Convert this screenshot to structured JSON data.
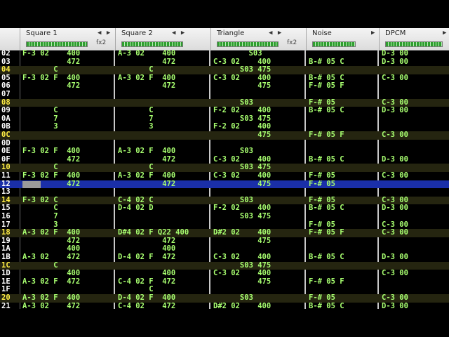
{
  "channels": [
    {
      "name": "Square 1",
      "fx": "fx2",
      "arrows": "◀ ▶"
    },
    {
      "name": "Square 2",
      "fx": "",
      "arrows": "◀ ▶"
    },
    {
      "name": "Triangle",
      "fx": "fx2",
      "arrows": "◀ ▶"
    },
    {
      "name": "Noise",
      "fx": "",
      "arrows": "▶"
    },
    {
      "name": "DPCM",
      "fx": "",
      "arrows": "▶"
    }
  ],
  "rows": [
    {
      "n": "02",
      "c": [
        "F-3 02    400",
        "A-3 02    400",
        "        S03  ",
        "",
        "D-3 00"
      ]
    },
    {
      "n": "03",
      "c": [
        "          472",
        "          472",
        "C-3 02    400",
        "B-# 05 C",
        "D-3 00"
      ]
    },
    {
      "n": "04",
      "c": [
        "       C     ",
        "       C     ",
        "      S03 475",
        "",
        ""
      ]
    },
    {
      "n": "05",
      "c": [
        "F-3 02 F  400",
        "A-3 02 F  400",
        "C-3 02    400",
        "B-# 05 C",
        "C-3 00"
      ]
    },
    {
      "n": "06",
      "c": [
        "          472",
        "          472",
        "          475",
        "F-# 05 F",
        ""
      ]
    },
    {
      "n": "07",
      "c": [
        "",
        "",
        "",
        "",
        ""
      ]
    },
    {
      "n": "08",
      "c": [
        "",
        "",
        "      S03    ",
        "F-# 05",
        "C-3 00"
      ]
    },
    {
      "n": "09",
      "c": [
        "       C     ",
        "       C     ",
        "F-2 02    400",
        "B-# 05 C",
        "D-3 00"
      ]
    },
    {
      "n": "0A",
      "c": [
        "       7     ",
        "       7     ",
        "      S03 475",
        "",
        ""
      ]
    },
    {
      "n": "0B",
      "c": [
        "       3     ",
        "       3     ",
        "F-2 02    400",
        "",
        ""
      ]
    },
    {
      "n": "0C",
      "c": [
        "",
        "",
        "          475",
        "F-# 05 F",
        "C-3 00"
      ]
    },
    {
      "n": "0D",
      "c": [
        "",
        "",
        "",
        "",
        ""
      ]
    },
    {
      "n": "0E",
      "c": [
        "F-3 02 F  400",
        "A-3 02 F  400",
        "      S03    ",
        "",
        ""
      ]
    },
    {
      "n": "0F",
      "c": [
        "          472",
        "          472",
        "C-3 02    400",
        "B-# 05 C",
        "D-3 00"
      ]
    },
    {
      "n": "10",
      "c": [
        "       C     ",
        "       C     ",
        "      S03 475",
        "",
        ""
      ]
    },
    {
      "n": "11",
      "c": [
        "F-3 02 F  400",
        "A-3 02 F  400",
        "C-3 02    400",
        "F-# 05",
        "C-3 00"
      ]
    },
    {
      "n": "12",
      "c": [
        "          472",
        "          472",
        "          475",
        "F-# 05",
        ""
      ]
    },
    {
      "n": "13",
      "c": [
        "",
        "",
        "",
        "",
        ""
      ]
    },
    {
      "n": "14",
      "c": [
        "F-3 02 C     ",
        "C-4 02 C     ",
        "      S03    ",
        "F-# 05",
        "C-3 00"
      ]
    },
    {
      "n": "15",
      "c": [
        "       C     ",
        "D-4 02 D     ",
        "F-2 02    400",
        "B-# 05 C",
        "D-3 00"
      ]
    },
    {
      "n": "16",
      "c": [
        "       7     ",
        "             ",
        "      S03 475",
        "",
        ""
      ]
    },
    {
      "n": "17",
      "c": [
        "       3     ",
        "             ",
        "",
        "F-# 05",
        "C-3 00"
      ]
    },
    {
      "n": "18",
      "c": [
        "A-3 02 F  400",
        "D#4 02 F Q22 400",
        "D#2 02    400",
        "F-# 05 F",
        "C-3 00"
      ]
    },
    {
      "n": "19",
      "c": [
        "          472",
        "          472",
        "          475",
        "",
        ""
      ]
    },
    {
      "n": "1A",
      "c": [
        "          400",
        "          400",
        "",
        "",
        ""
      ]
    },
    {
      "n": "1B",
      "c": [
        "A-3 02    472",
        "D-4 02 F  472",
        "C-3 02    400",
        "B-# 05 C",
        "D-3 00"
      ]
    },
    {
      "n": "1C",
      "c": [
        "       C     ",
        "             ",
        "      S03 475",
        "",
        ""
      ]
    },
    {
      "n": "1D",
      "c": [
        "          400",
        "          400",
        "C-3 02    400",
        "",
        "C-3 00"
      ]
    },
    {
      "n": "1E",
      "c": [
        "A-3 02 F  472",
        "C-4 02 F  472",
        "          475",
        "F-# 05 F",
        ""
      ]
    },
    {
      "n": "1F",
      "c": [
        "             ",
        "       C     ",
        "",
        "",
        ""
      ]
    },
    {
      "n": "20",
      "c": [
        "A-3 02 F  400",
        "D-4 02 F  400",
        "      S03    ",
        "F-# 05",
        "C-3 00"
      ]
    },
    {
      "n": "21",
      "c": [
        "A-3 02    472",
        "C-4 02    472",
        "D#2 02    400",
        "B-# 05 C",
        "D-3 00"
      ]
    }
  ],
  "current_row": "12",
  "highlight_rows": [
    "04",
    "08",
    "0C",
    "10",
    "14",
    "18",
    "1C",
    "20"
  ]
}
